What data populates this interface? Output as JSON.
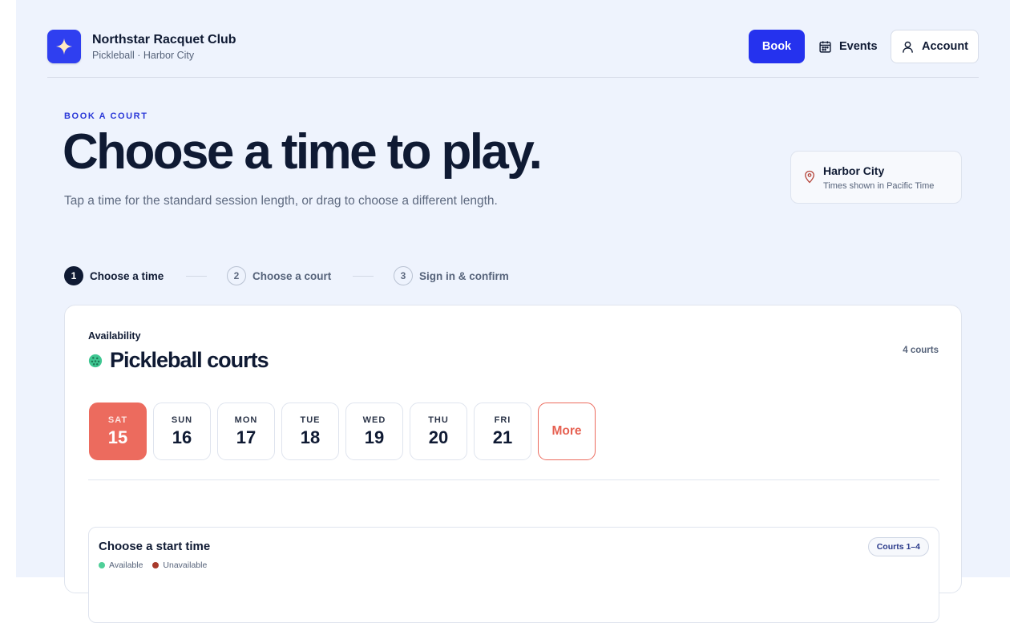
{
  "brand": {
    "name": "Northstar Racquet Club",
    "subtitle": "Pickleball · Harbor City",
    "logo_color": "#2f3ff0"
  },
  "nav": {
    "book_label": "Book",
    "events_label": "Events",
    "account_label": "Account",
    "accent": "#2532ee"
  },
  "hero": {
    "eyebrow": "BOOK A COURT",
    "title": "Choose a time to play.",
    "subtitle": "Tap a time for the standard session length, or drag to choose a different length."
  },
  "location": {
    "title": "Harbor City",
    "subtitle": "Times shown in Pacific Time",
    "icon": "map-pin-icon"
  },
  "stepper": {
    "steps": [
      {
        "number": "1",
        "label": "Choose a time",
        "active": true
      },
      {
        "number": "2",
        "label": "Choose a court",
        "active": false
      },
      {
        "number": "3",
        "label": "Sign in & confirm",
        "active": false
      }
    ]
  },
  "availability": {
    "kicker": "Availability",
    "title": "Pickleball courts",
    "court_count": "4 courts",
    "days": [
      {
        "dow": "SAT",
        "num": "15",
        "selected": true
      },
      {
        "dow": "SUN",
        "num": "16",
        "selected": false
      },
      {
        "dow": "MON",
        "num": "17",
        "selected": false
      },
      {
        "dow": "TUE",
        "num": "18",
        "selected": false
      },
      {
        "dow": "WED",
        "num": "19",
        "selected": false
      },
      {
        "dow": "THU",
        "num": "20",
        "selected": false
      },
      {
        "dow": "FRI",
        "num": "21",
        "selected": false
      }
    ],
    "more_label": "More",
    "selected_color": "#ec6b5e"
  },
  "start_time": {
    "title": "Choose a start time",
    "legend": {
      "available": "Available",
      "unavailable": "Unavailable",
      "available_color": "#4fcf98",
      "unavailable_color": "#a83a2c"
    },
    "courts_badge": "Courts 1–4"
  }
}
